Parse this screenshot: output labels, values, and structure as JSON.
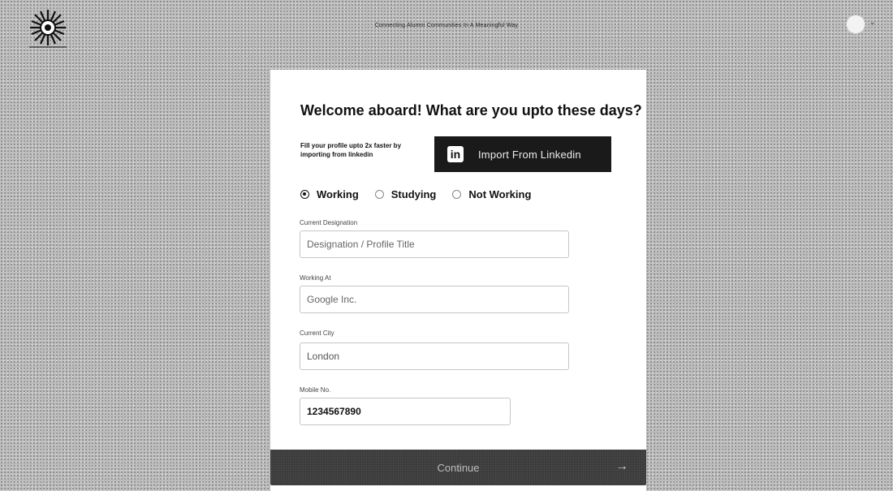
{
  "header": {
    "tagline": "Connecting Alumni Communities In A Meaningful Way",
    "logo_icon": "sunburst-logo-icon",
    "avatar_icon": "user-avatar-icon",
    "caret_icon": "chevron-down-icon",
    "caret_glyph": "⌄"
  },
  "form": {
    "title": "Welcome aboard! What are you upto these days?",
    "import_hint": "Fill your profile upto 2x faster by importing from linkedin",
    "linkedin_button": {
      "icon_glyph": "in",
      "label": "Import From Linkedin"
    },
    "status_options": [
      {
        "label": "Working",
        "checked": true
      },
      {
        "label": "Studying",
        "checked": false
      },
      {
        "label": "Not Working",
        "checked": false
      }
    ],
    "fields": {
      "designation": {
        "label": "Current Designation",
        "placeholder": "Designation / Profile Title",
        "value": ""
      },
      "working_at": {
        "label": "Working At",
        "placeholder": "Google Inc.",
        "value": ""
      },
      "city": {
        "label": "Current City",
        "placeholder": "",
        "value": "London"
      },
      "mobile": {
        "label": "Mobile No.",
        "placeholder": "",
        "value": "1234567890"
      }
    },
    "continue": {
      "label": "Continue",
      "arrow_glyph": "→"
    }
  }
}
